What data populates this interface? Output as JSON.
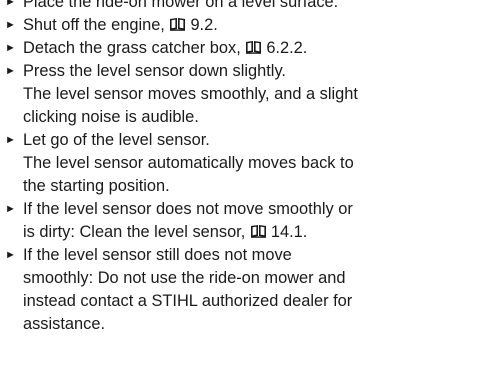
{
  "steps": [
    {
      "lines": [
        "Place the ride-on mower on a level surface."
      ]
    },
    {
      "text": "Shut off the engine,",
      "ref": "9.2."
    },
    {
      "text": "Detach the grass catcher box,",
      "ref": "6.2.2."
    },
    {
      "lines": [
        "Press the level sensor down slightly.",
        "The level sensor moves smoothly, and a slight",
        "clicking noise is audible."
      ]
    },
    {
      "lines": [
        "Let go of the level sensor.",
        "The level sensor automatically moves back to",
        "the starting position."
      ]
    },
    {
      "line1": "If the level sensor does not move smoothly or",
      "line2": "is dirty: Clean the level sensor,",
      "ref": "14.1."
    },
    {
      "lines": [
        "If the level sensor still does not move",
        "smoothly: Do not use the ride-on mower and",
        "instead contact a STIHL authorized dealer for",
        "assistance."
      ]
    }
  ],
  "icons": {
    "bullet": "triangle-right-bullet",
    "reference": "book-icon"
  }
}
